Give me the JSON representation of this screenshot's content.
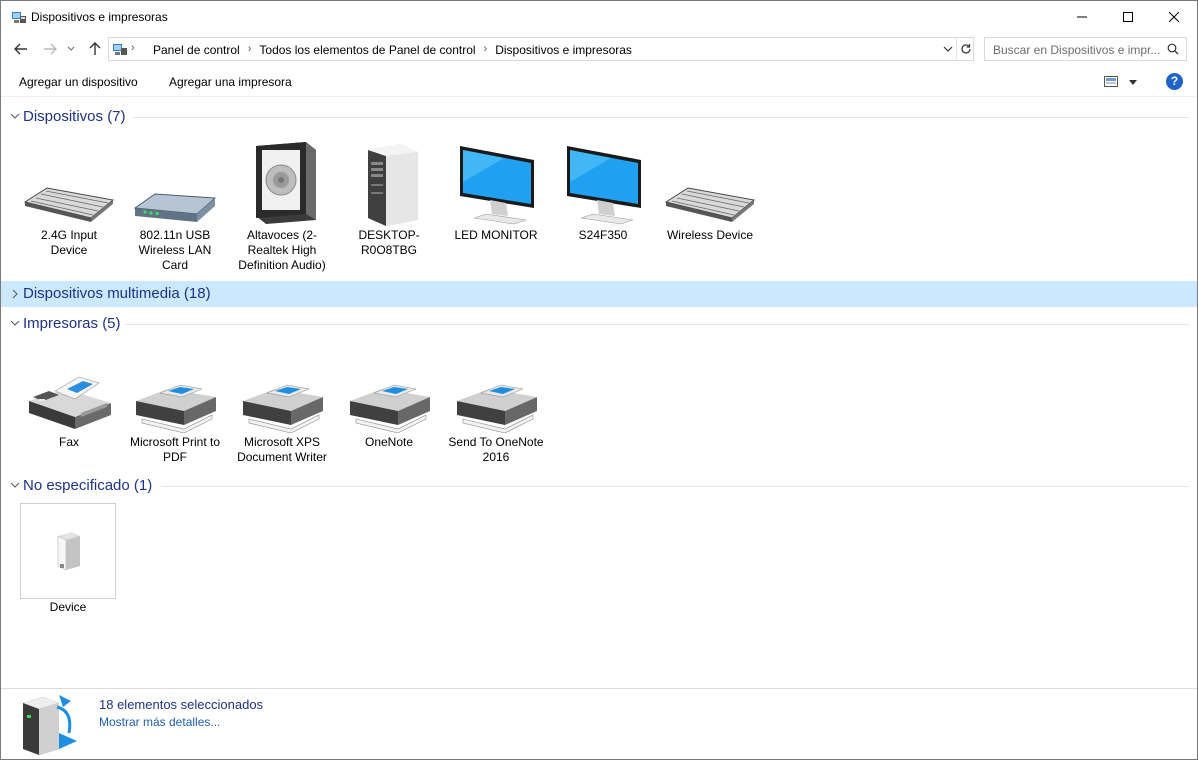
{
  "window": {
    "title": "Dispositivos e impresoras",
    "minimize_label": "Minimizar",
    "maximize_label": "Maximizar",
    "close_label": "Cerrar"
  },
  "address": {
    "crumbs": [
      "Panel de control",
      "Todos los elementos de Panel de control",
      "Dispositivos e impresoras"
    ],
    "search_placeholder": "Buscar en Dispositivos e impr..."
  },
  "commands": {
    "add_device": "Agregar un dispositivo",
    "add_printer": "Agregar una impresora"
  },
  "groups": {
    "devices": {
      "title": "Dispositivos (7)",
      "items": [
        {
          "label": "2.4G Input Device",
          "icon": "keyboard-icon"
        },
        {
          "label": "802.11n USB Wireless LAN Card",
          "icon": "network-adapter-icon"
        },
        {
          "label": "Altavoces (2- Realtek High Definition Audio)",
          "icon": "speaker-icon"
        },
        {
          "label": "DESKTOP-R0O8TBG",
          "icon": "computer-tower-icon"
        },
        {
          "label": "LED MONITOR",
          "icon": "monitor-icon"
        },
        {
          "label": "S24F350",
          "icon": "monitor-icon"
        },
        {
          "label": "Wireless Device",
          "icon": "keyboard-icon"
        }
      ]
    },
    "multimedia": {
      "title": "Dispositivos multimedia (18)"
    },
    "printers": {
      "title": "Impresoras (5)",
      "items": [
        {
          "label": "Fax",
          "icon": "fax-icon"
        },
        {
          "label": "Microsoft Print to PDF",
          "icon": "printer-icon"
        },
        {
          "label": "Microsoft XPS Document Writer",
          "icon": "printer-icon"
        },
        {
          "label": "OneNote",
          "icon": "printer-icon"
        },
        {
          "label": "Send To OneNote 2016",
          "icon": "printer-icon"
        }
      ]
    },
    "unspecified": {
      "title": "No especificado (1)",
      "items": [
        {
          "label": "Device",
          "icon": "generic-device-icon"
        }
      ]
    }
  },
  "status": {
    "selected_text": "18 elementos seleccionados",
    "more_details": "Mostrar más detalles..."
  },
  "colors": {
    "group_title": "#1e3287",
    "selected_group_bg": "#cce8ff",
    "link": "#1e5fb4",
    "help_blue": "#1e64c8"
  }
}
